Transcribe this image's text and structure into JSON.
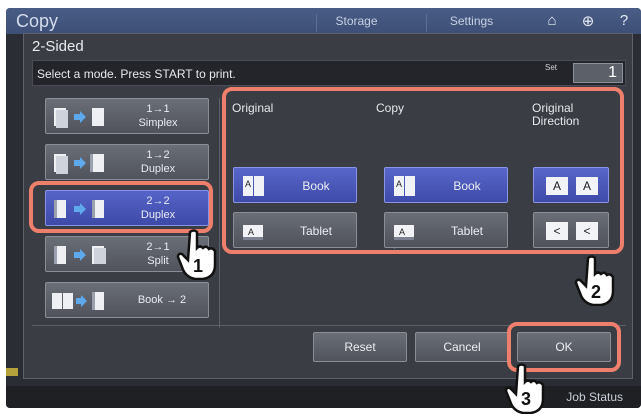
{
  "app": {
    "title": "Copy",
    "tabs": [
      "Storage",
      "Settings"
    ],
    "job_status": "Job Status"
  },
  "dialog": {
    "title": "2-Sided",
    "message": "Select a mode. Press START to print.",
    "set_label": "Set",
    "set_value": "1"
  },
  "modes": [
    {
      "line1": "1→1",
      "line2": "Simplex",
      "selected": false
    },
    {
      "line1": "1→2",
      "line2": "Duplex",
      "selected": false
    },
    {
      "line1": "2→2",
      "line2": "Duplex",
      "selected": true
    },
    {
      "line1": "2→1",
      "line2": "Split",
      "selected": false
    },
    {
      "line1": "Book → 2",
      "line2": "",
      "selected": false
    }
  ],
  "sections": {
    "original": "Original",
    "copy": "Copy",
    "direction_line1": "Original",
    "direction_line2": "Direction"
  },
  "original_options": [
    {
      "label": "Book",
      "icon": "book-page-icon",
      "selected": true
    },
    {
      "label": "Tablet",
      "icon": "tablet-page-icon",
      "selected": false
    }
  ],
  "copy_options": [
    {
      "label": "Book",
      "icon": "book-page-icon",
      "selected": true
    },
    {
      "label": "Tablet",
      "icon": "tablet-page-icon",
      "selected": false
    }
  ],
  "direction_options": [
    {
      "glyph": "A",
      "selected": true
    },
    {
      "glyph": "<",
      "selected": false
    }
  ],
  "buttons": {
    "reset": "Reset",
    "cancel": "Cancel",
    "ok": "OK"
  },
  "callouts": [
    "1",
    "2",
    "3"
  ],
  "colors": {
    "accent": "#4b57b9",
    "highlight": "#ee7f6c",
    "topbar": "#44567e"
  }
}
